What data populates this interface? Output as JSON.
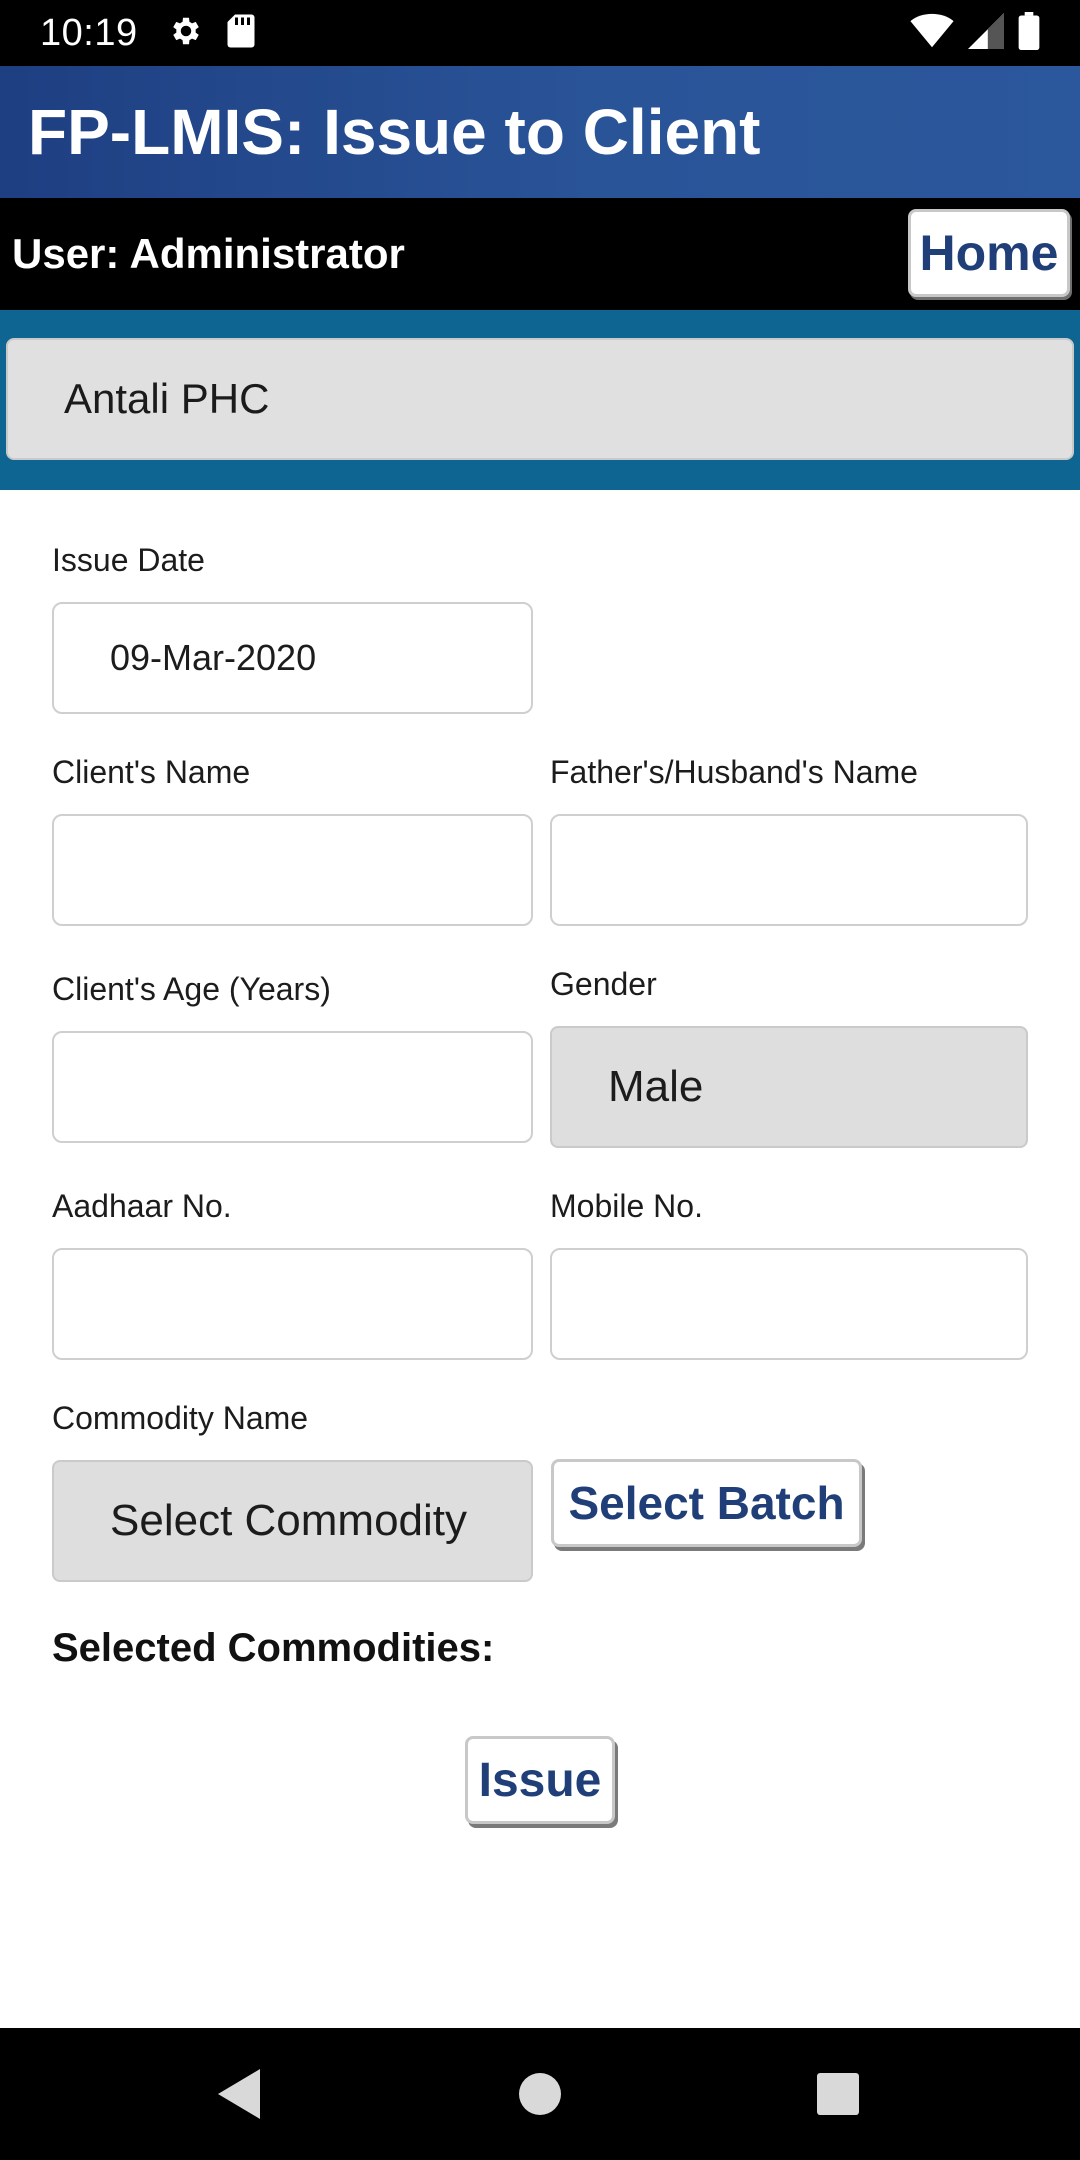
{
  "status_bar": {
    "time": "10:19",
    "left_icons": [
      "gear-icon",
      "sd-card-icon"
    ],
    "right_icons": [
      "wifi-icon",
      "cellular-signal-icon",
      "battery-icon"
    ]
  },
  "header": {
    "title": "FP-LMIS: Issue to Client"
  },
  "user_bar": {
    "user_label": "User: Administrator",
    "home_label": "Home"
  },
  "facility": {
    "selected": "Antali PHC"
  },
  "form": {
    "issue_date_label": "Issue Date",
    "issue_date_value": "09-Mar-2020",
    "client_name_label": "Client's Name",
    "client_name_value": "",
    "father_husband_label": "Father's/Husband's Name",
    "father_husband_value": "",
    "client_age_label": "Client's Age (Years)",
    "client_age_value": "",
    "gender_label": "Gender",
    "gender_selected": "Male",
    "aadhaar_label": "Aadhaar No.",
    "aadhaar_value": "",
    "mobile_label": "Mobile No.",
    "mobile_value": "",
    "commodity_label": "Commodity Name",
    "commodity_selected": "Select Commodity",
    "select_batch_label": "Select Batch",
    "selected_commodities_heading": "Selected Commodities:",
    "issue_label": "Issue"
  },
  "nav_bar": {
    "buttons": [
      "back-icon",
      "home-circle-icon",
      "recents-square-icon"
    ]
  },
  "colors": {
    "header_blue": "#2a5498",
    "band_teal": "#0e6591",
    "button_text": "#203f78"
  }
}
